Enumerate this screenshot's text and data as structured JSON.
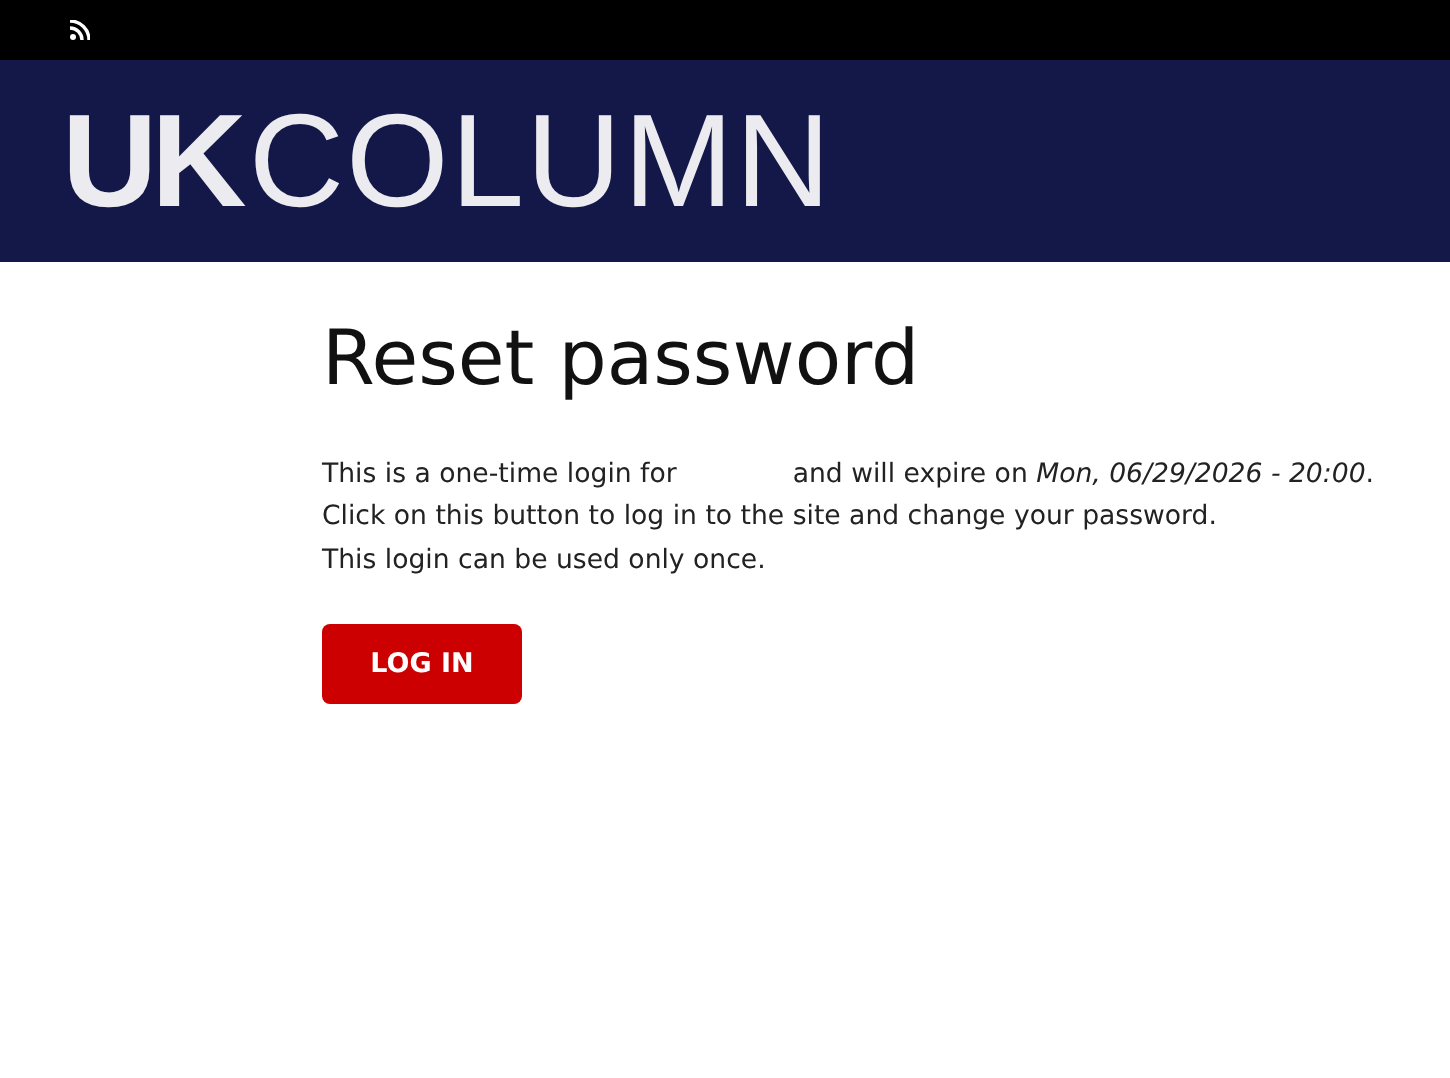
{
  "logo": "**UK**COLUMN",
  "title": "Reset password",
  "message": {
    "before": "This is a one-time login for",
    "after": "and will expire on *Mon, 06/29/2026 - 20:00*."
  },
  "lines": [
    "Click on this button to log in to the site and change your password.",
    "This login can be used only once."
  ],
  "button": "LOG IN"
}
